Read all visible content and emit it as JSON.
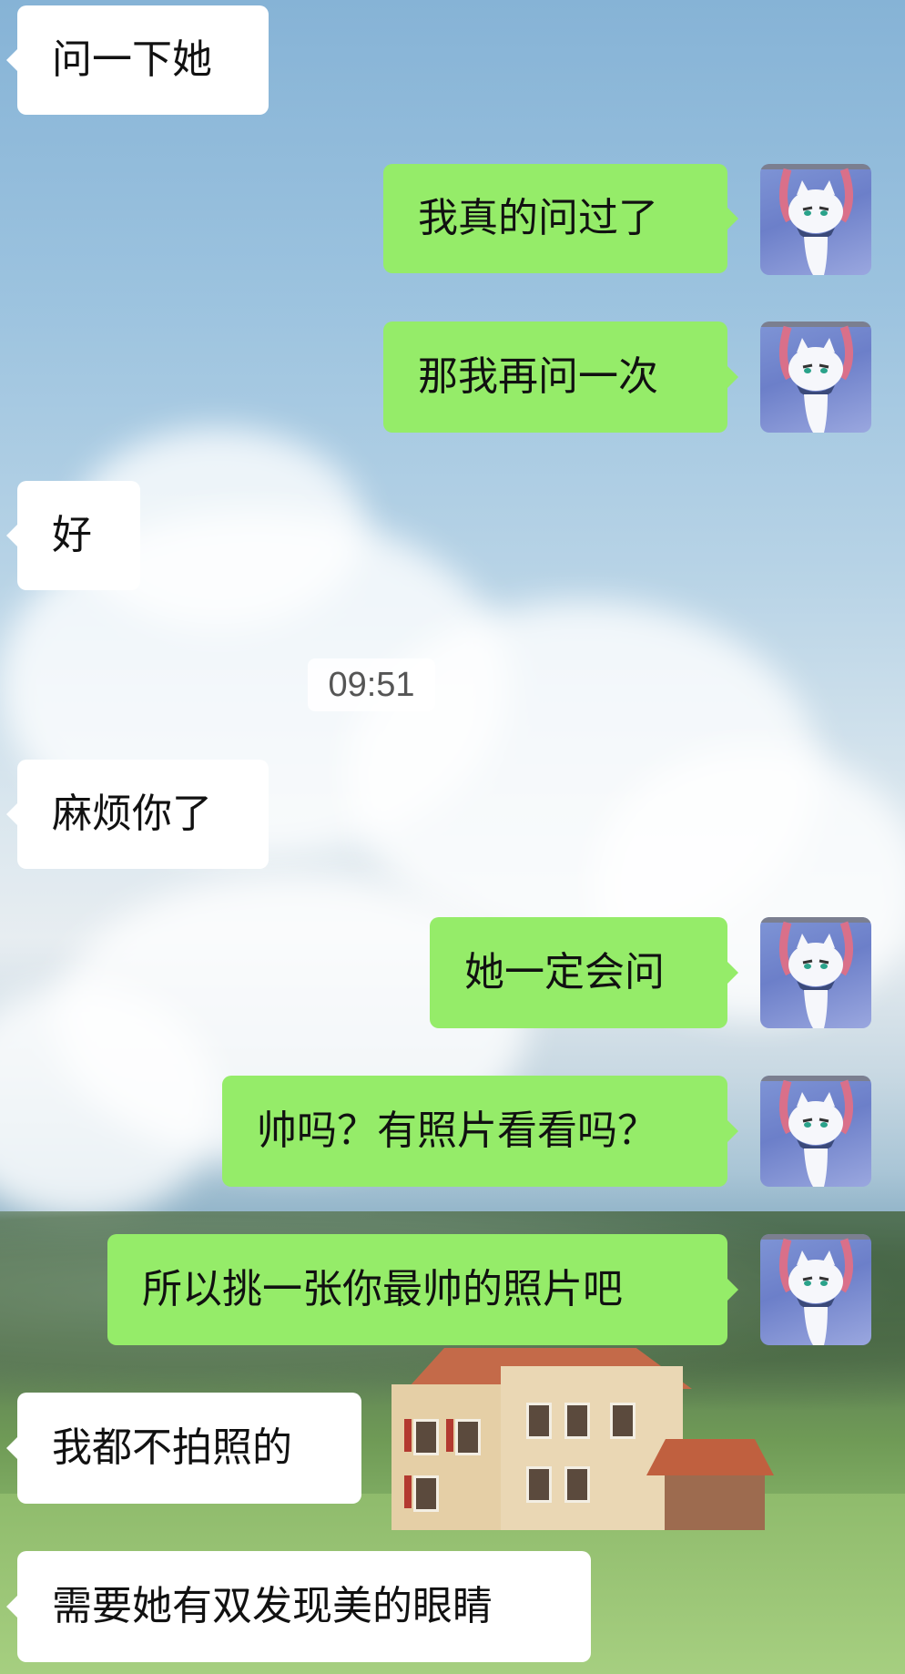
{
  "chat": {
    "timestamp": "09:51",
    "messages": [
      {
        "side": "left",
        "text": "问一下她"
      },
      {
        "side": "right",
        "text": "我真的问过了"
      },
      {
        "side": "right",
        "text": "那我再问一次"
      },
      {
        "side": "left",
        "text": "好"
      },
      {
        "side": "left",
        "text": "麻烦你了"
      },
      {
        "side": "right",
        "text": "她一定会问"
      },
      {
        "side": "right",
        "text": "帅吗？有照片看看吗？"
      },
      {
        "side": "right",
        "text": "所以挑一张你最帅的照片吧"
      },
      {
        "side": "left",
        "text": "我都不拍照的"
      },
      {
        "side": "left",
        "text": "需要她有双发现美的眼睛"
      }
    ]
  },
  "colors": {
    "outgoing_bubble": "#95ec69",
    "incoming_bubble": "#ffffff"
  },
  "avatar": {
    "icon": "cartoon-cat-avatar-icon"
  }
}
